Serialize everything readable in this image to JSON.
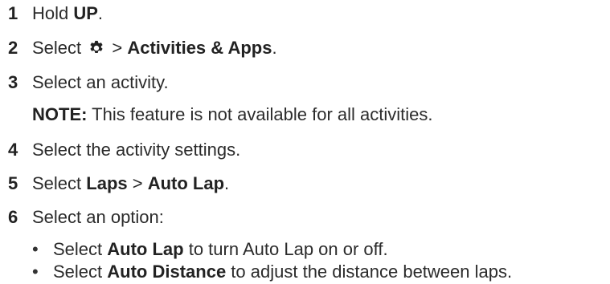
{
  "steps": [
    {
      "num": "1",
      "pre": "Hold ",
      "bold": "UP",
      "post": "."
    },
    {
      "num": "2",
      "pre": "Select ",
      "sep": " > ",
      "bold": "Activities & Apps",
      "post": "."
    },
    {
      "num": "3",
      "text": "Select an activity."
    },
    {
      "num": "4",
      "text": "Select the activity settings."
    },
    {
      "num": "5",
      "pre": "Select ",
      "bold1": "Laps",
      "sep": " > ",
      "bold2": "Auto Lap",
      "post": "."
    },
    {
      "num": "6",
      "text": "Select an option:"
    }
  ],
  "note": {
    "label": "NOTE:",
    "text": " This feature is not available for all activities."
  },
  "bullets": [
    {
      "pre": "Select ",
      "bold": "Auto Lap",
      "post": " to turn Auto Lap on or off."
    },
    {
      "pre": "Select ",
      "bold": "Auto Distance",
      "post": " to adjust the distance between laps."
    }
  ],
  "icons": {
    "step2": "gear-icon"
  }
}
